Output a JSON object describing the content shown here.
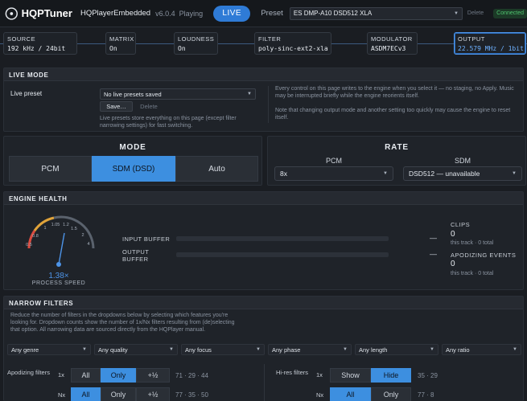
{
  "header": {
    "brand": "HQPTuner",
    "app_name": "HQPlayerEmbedded",
    "version": "v6.0.4",
    "state": "Playing",
    "live_button": "LIVE",
    "preset_label": "Preset",
    "preset_value": "ES DMP-A10 DSD512 XLA",
    "delete_label": "Delete",
    "connection_status": "Connected"
  },
  "pipeline": [
    {
      "label": "SOURCE",
      "value": "192 kHz / 24bit"
    },
    {
      "label": "MATRIX",
      "value": "On"
    },
    {
      "label": "LOUDNESS",
      "value": "On"
    },
    {
      "label": "FILTER",
      "value": "poly-sinc-ext2-xla"
    },
    {
      "label": "MODULATOR",
      "value": "ASDM7ECv3"
    },
    {
      "label": "OUTPUT",
      "value": "22.579 MHz / 1bit"
    }
  ],
  "live_mode": {
    "title": "LIVE MODE",
    "preset_label": "Live preset",
    "preset_value": "No live presets saved",
    "save_label": "Save…",
    "delete_label": "Delete",
    "help": "Live presets store everything on this page (except filter narrowing settings) for fast switching.",
    "note1": "Every control on this page writes to the engine when you select it — no staging, no Apply. Music may be interrupted briefly while the engine reorients itself.",
    "note2": "Note that changing output mode and another setting too quickly may cause the engine to reset itself."
  },
  "mode": {
    "title": "MODE",
    "options": [
      "PCM",
      "SDM (DSD)",
      "Auto"
    ],
    "selected": "SDM (DSD)"
  },
  "rate": {
    "title": "RATE",
    "pcm_label": "PCM",
    "pcm_value": "8x",
    "sdm_label": "SDM",
    "sdm_value": "DSD512 — unavailable"
  },
  "engine_health": {
    "title": "ENGINE HEALTH",
    "gauge_ticks": [
      "0.5",
      "0.8",
      "1",
      "1.05",
      "1.2",
      "1.5",
      "2",
      "4"
    ],
    "process_speed_value": "1.38×",
    "process_speed_label": "PROCESS SPEED",
    "input_buffer_label": "INPUT BUFFER",
    "input_buffer_value": "—",
    "output_buffer_label": "OUTPUT BUFFER",
    "output_buffer_value": "—",
    "clips_label": "CLIPS",
    "clips_value": "0",
    "clips_sub": "this track · 0 total",
    "apod_label": "APODIZING EVENTS",
    "apod_value": "0",
    "apod_sub": "this track · 0 total"
  },
  "narrow_filters": {
    "title": "NARROW FILTERS",
    "description": "Reduce the number of filters in the dropdowns below by selecting which features you're looking for. Dropdown counts show the number of 1x/Nx filters resulting from (de)selecting that option. All narrowing data are sourced directly from the HQPlayer manual.",
    "selects": [
      "Any genre",
      "Any quality",
      "Any focus",
      "Any phase",
      "Any length",
      "Any ratio"
    ],
    "apodizing": {
      "label": "Apodizing filters",
      "row1x": {
        "rate": "1x",
        "options": [
          "All",
          "Only",
          "+½"
        ],
        "selected": "Only",
        "counts": "71 · 29 · 44"
      },
      "rowNx": {
        "rate": "Nx",
        "options": [
          "All",
          "Only",
          "+½"
        ],
        "selected": "All",
        "counts": "77 · 35 · 50"
      }
    },
    "hires": {
      "label": "Hi-res filters",
      "row1x": {
        "rate": "1x",
        "options": [
          "Show",
          "Hide"
        ],
        "selected": "Hide",
        "counts": "35 · 29"
      },
      "rowNx": {
        "rate": "Nx",
        "options": [
          "All",
          "Only"
        ],
        "selected": "All",
        "counts": "77 · 8"
      }
    }
  },
  "colors": {
    "accent": "#3d8fe0",
    "live": "#2f7bd6",
    "connected": "#4fc46f",
    "output_value": "#6eb1ff"
  }
}
